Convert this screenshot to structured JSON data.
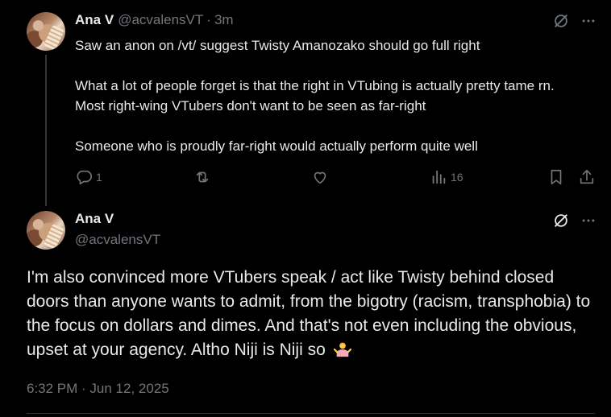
{
  "reply_tweet": {
    "author_name": "Ana V",
    "author_handle": "@acvalensVT",
    "separator": "·",
    "relative_time": "3m",
    "paragraphs": [
      "Saw an anon on /vt/ suggest Twisty Amanozako should go full right",
      "What a lot of people forget is that the right in VTubing is actually pretty tame rn. Most right-wing VTubers don't want to be seen as far-right",
      "Someone who is proudly far-right would actually perform quite well"
    ],
    "actions": {
      "reply_count": "1",
      "retweet_count": "",
      "like_count": "",
      "views_count": "16"
    }
  },
  "main_tweet": {
    "author_name": "Ana V",
    "author_handle": "@acvalensVT",
    "text": "I'm also convinced more VTubers speak / act like Twisty behind closed doors than anyone wants to admit, from the bigotry (racism, transphobia) to the focus on dollars and dimes. And that's not even including the obvious, upset at your agency. Altho Niji is Niji so",
    "timestamp": "6:32 PM · Jun 12, 2025"
  },
  "colors": {
    "background": "#000000",
    "text_primary": "#e7e9ea",
    "text_secondary": "#71767b",
    "divider": "#2f3336"
  },
  "icons": [
    "grok-icon",
    "more-icon",
    "reply-icon",
    "retweet-icon",
    "like-icon",
    "views-icon",
    "bookmark-icon",
    "share-icon",
    "person-shrugging-emoji"
  ]
}
